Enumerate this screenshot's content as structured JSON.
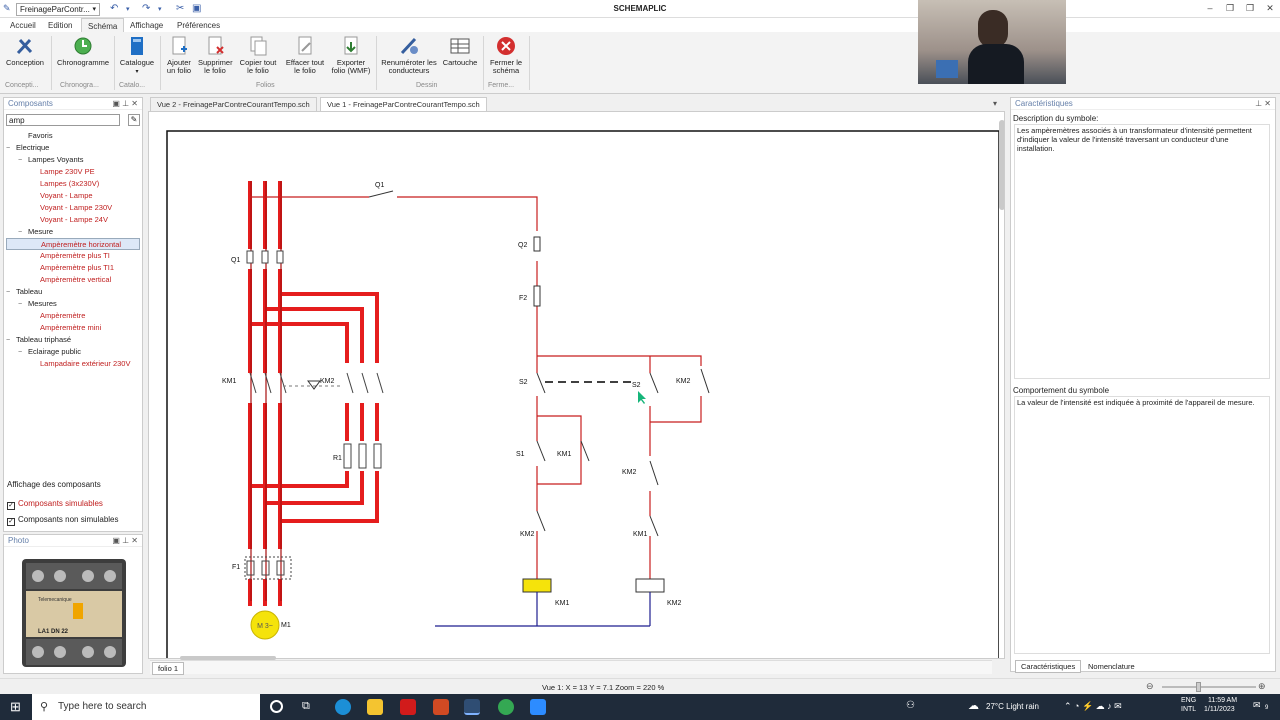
{
  "titlebar": {
    "doc_dropdown": "FreinageParContr...",
    "app_title": "SCHEMAPLIC"
  },
  "menu_tabs": [
    "Accueil",
    "Edition",
    "Schéma",
    "Affichage",
    "Préférences"
  ],
  "ribbon": {
    "buttons": [
      "Conception",
      "Chronogramme",
      "Catalogue",
      "Ajouter un folio",
      "Supprimer le folio",
      "Copier tout le folio",
      "Effacer tout le folio",
      "Exporter folio (WMF)",
      "Renuméroter les conducteurs",
      "Cartouche",
      "Fermer le schéma"
    ],
    "groups": [
      "Concepti...",
      "Chronogra...",
      "Catalo...",
      "Folios",
      "Dessin",
      "Ferme..."
    ]
  },
  "components": {
    "title": "Composants",
    "search_value": "amp",
    "tree": [
      {
        "t": "Favoris",
        "l": 1,
        "e": ""
      },
      {
        "t": "Electrique",
        "l": 0,
        "e": "−"
      },
      {
        "t": "Lampes Voyants",
        "l": 1,
        "e": "−"
      },
      {
        "t": "Lampe 230V PE",
        "l": 2,
        "e": "",
        "red": true
      },
      {
        "t": "Lampes (3x230V)",
        "l": 2,
        "e": "",
        "red": true
      },
      {
        "t": "Voyant - Lampe",
        "l": 2,
        "e": "",
        "red": true
      },
      {
        "t": "Voyant - Lampe 230V",
        "l": 2,
        "e": "",
        "red": true
      },
      {
        "t": "Voyant - Lampe 24V",
        "l": 2,
        "e": "",
        "red": true
      },
      {
        "t": "Mesure",
        "l": 1,
        "e": "−"
      },
      {
        "t": "Ampèremètre horizontal",
        "l": 2,
        "e": "",
        "red": true,
        "sel": true
      },
      {
        "t": "Ampèremètre plus TI",
        "l": 2,
        "e": "",
        "red": true
      },
      {
        "t": "Ampèremètre plus TI1",
        "l": 2,
        "e": "",
        "red": true
      },
      {
        "t": "Ampèremètre vertical",
        "l": 2,
        "e": "",
        "red": true
      },
      {
        "t": "Tableau",
        "l": 0,
        "e": "−"
      },
      {
        "t": "Mesures",
        "l": 1,
        "e": "−"
      },
      {
        "t": "Ampèremètre",
        "l": 2,
        "e": "",
        "red": true
      },
      {
        "t": "Ampèremètre mini",
        "l": 2,
        "e": "",
        "red": true
      },
      {
        "t": "Tableau triphasé",
        "l": 0,
        "e": "−"
      },
      {
        "t": "Eclairage public",
        "l": 1,
        "e": "−"
      },
      {
        "t": "Lampadaire extérieur 230V",
        "l": 2,
        "e": "",
        "red": true
      }
    ],
    "display_label": "Affichage des composants",
    "chk_simulables": "Composants simulables",
    "chk_non_simulables": "Composants non simulables"
  },
  "photo": {
    "title": "Photo",
    "brand": "Telemecanique",
    "model": "LA1 DN 22"
  },
  "views": {
    "tab1": "Vue 2 - FreinageParContreCourantTempo.sch",
    "tab2": "Vue 1 - FreinageParContreCourantTempo.sch",
    "folio": "folio 1"
  },
  "schematic": {
    "labels": {
      "q1": "Q1",
      "km1": "KM1",
      "km2": "KM2",
      "r1": "R1",
      "f1": "F1",
      "m1": "M1",
      "motor": "M 3~",
      "q2": "Q2",
      "f2": "F2",
      "s2": "S2",
      "s1": "S1"
    }
  },
  "status": "Vue 1: X = 13 Y = 7.1 Zoom = 220 %",
  "characteristics": {
    "title": "Caractéristiques",
    "desc_label": "Description du symbole:",
    "desc_text": "Les ampèremètres associés à un transformateur d'intensité permettent d'indiquer la valeur de l'intensité traversant un conducteur d'une installation.",
    "behavior_label": "Comportement du symbole",
    "behavior_text": "La valeur de l'intensité est indiquée à proximité de l'appareil de mesure.",
    "tabs": [
      "Caractéristiques",
      "Nomenclature"
    ]
  },
  "taskbar": {
    "search": "Type here to search",
    "weather": "27°C Light rain",
    "lang": "ENG",
    "lang2": "INTL",
    "time": "11:59 AM",
    "date": "1/11/2023",
    "notif": "9"
  },
  "colors": {
    "wire_red": "#e51d1d",
    "wire_dark": "#a80f0f",
    "coil_on": "#f5e30b",
    "neutral": "#1f1f8f"
  }
}
